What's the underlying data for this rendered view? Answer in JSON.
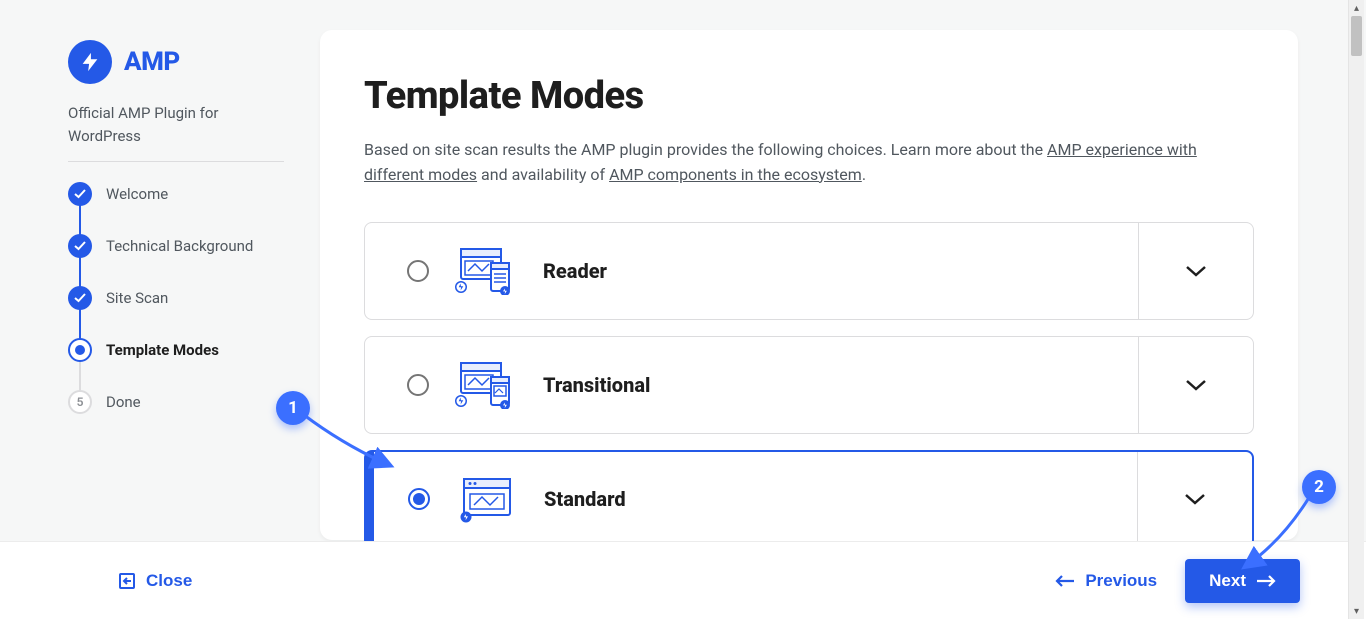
{
  "brand": {
    "name": "AMP",
    "subtitle": "Official AMP Plugin for WordPress"
  },
  "steps": [
    {
      "label": "Welcome",
      "state": "done"
    },
    {
      "label": "Technical Background",
      "state": "done"
    },
    {
      "label": "Site Scan",
      "state": "done"
    },
    {
      "label": "Template Modes",
      "state": "current"
    },
    {
      "label": "Done",
      "state": "future",
      "number": "5"
    }
  ],
  "page": {
    "title": "Template Modes",
    "desc_prefix": "Based on site scan results the AMP plugin provides the following choices. Learn more about the ",
    "link1": "AMP experience with different modes",
    "desc_mid": " and availability of ",
    "link2": "AMP components in the ecosystem",
    "desc_suffix": "."
  },
  "options": [
    {
      "label": "Reader",
      "selected": false
    },
    {
      "label": "Transitional",
      "selected": false
    },
    {
      "label": "Standard",
      "selected": true
    }
  ],
  "footer": {
    "close": "Close",
    "previous": "Previous",
    "next": "Next"
  },
  "annotations": {
    "a1": "1",
    "a2": "2"
  }
}
